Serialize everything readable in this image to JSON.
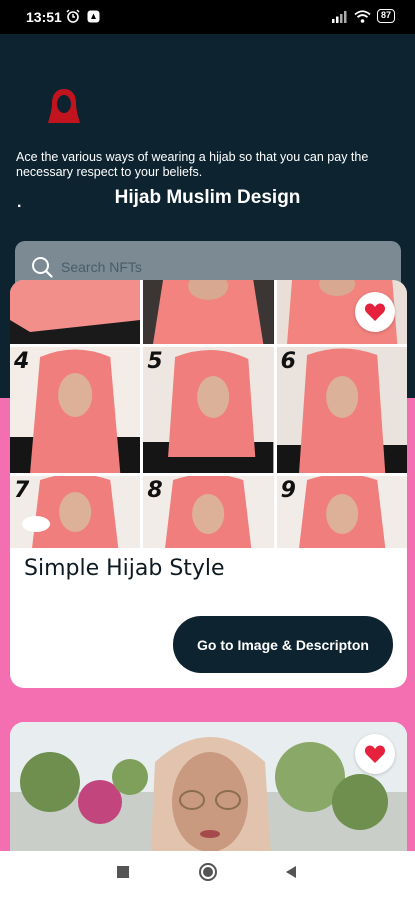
{
  "status": {
    "time": "13:51",
    "battery": "87"
  },
  "header": {
    "intro": "Ace the various ways of wearing a hijab so that you can pay the necessary respect to your beliefs.",
    "dot": ".",
    "title": "Hijab Muslim Design"
  },
  "search": {
    "placeholder": "Search NFTs"
  },
  "cards": [
    {
      "title": "Simple Hijab Style",
      "button": "Go to Image & Descripton",
      "steps": [
        "4",
        "5",
        "6",
        "7",
        "8",
        "9"
      ]
    },
    {
      "title": ""
    }
  ],
  "colors": {
    "header_bg": "#0d2330",
    "page_bg": "#f36fb1",
    "accent_red": "#e5213b",
    "hijab_pink": "#f07e7c"
  }
}
